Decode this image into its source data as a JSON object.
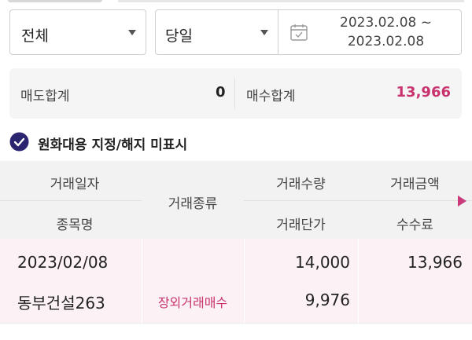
{
  "filters": {
    "account_type": "전체",
    "period": "당일",
    "date_range": {
      "start": "2023.02.08 ~",
      "end": "2023.02.08"
    }
  },
  "summary": {
    "sell_label": "매도합계",
    "sell_value": "0",
    "buy_label": "매수합계",
    "buy_value": "13,966"
  },
  "option": {
    "label": "원화대용 지정/해지 미표시",
    "checked": true
  },
  "table": {
    "headers": {
      "trade_date": "거래일자",
      "stock_name": "종목명",
      "trade_type": "거래종류",
      "quantity": "거래수량",
      "unit_price": "거래단가",
      "amount": "거래금액",
      "fee": "수수료"
    },
    "rows": [
      {
        "trade_date": "2023/02/08",
        "stock_name": "동부건설263",
        "trade_type": "장외거래매수",
        "quantity": "14,000",
        "unit_price": "9,976",
        "amount": "13,966",
        "fee": ""
      }
    ]
  },
  "colors": {
    "accent": "#c8326e",
    "check_fill": "#2b2570",
    "row_highlight": "#fcf1f5"
  }
}
